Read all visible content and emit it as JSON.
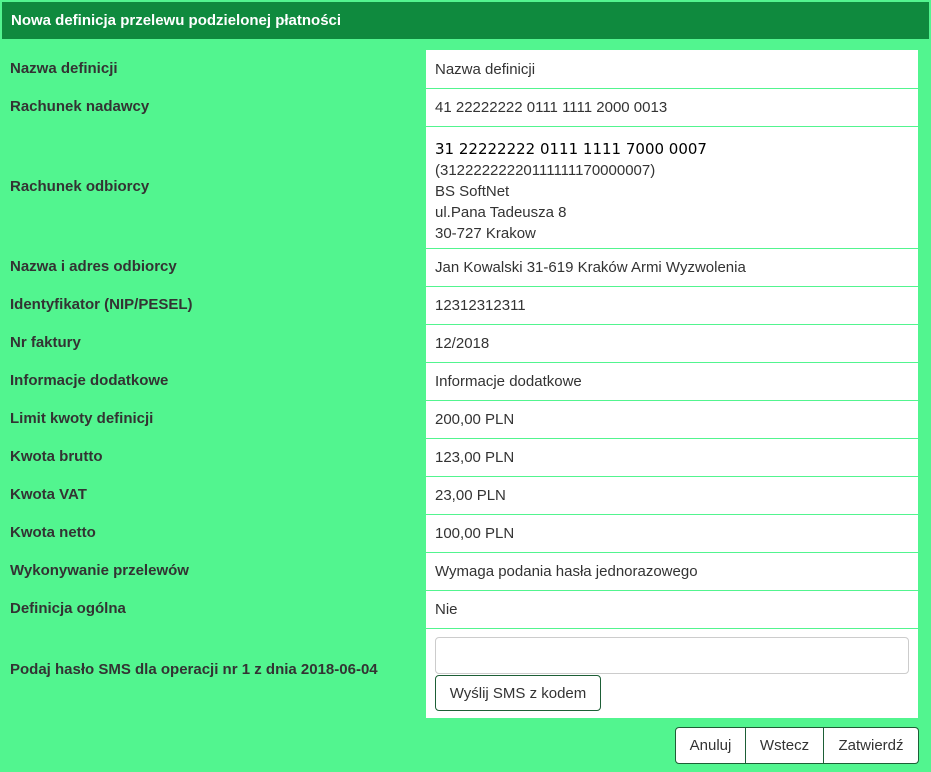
{
  "header": {
    "title": "Nowa definicja przelewu podzielonej płatności"
  },
  "fields": {
    "nazwa_definicji": {
      "label": "Nazwa definicji",
      "value": "Nazwa definicji"
    },
    "rachunek_nadawcy": {
      "label": "Rachunek nadawcy",
      "value": "41 22222222 0111 1111 2000 0013"
    },
    "rachunek_odbiorcy": {
      "label": "Rachunek odbiorcy",
      "account": "31 22222222 0111 1111 7000 0007",
      "account_raw": "(31222222220111111170000007)",
      "bank_name": "BS SoftNet",
      "street": "ul.Pana Tadeusza 8",
      "city": "30-727 Krakow"
    },
    "nazwa_adres_odbiorcy": {
      "label": "Nazwa i adres odbiorcy",
      "value": "Jan Kowalski 31-619 Kraków Armi Wyzwolenia"
    },
    "identyfikator": {
      "label": "Identyfikator (NIP/PESEL)",
      "value": "12312312311"
    },
    "nr_faktury": {
      "label": "Nr faktury",
      "value": "12/2018"
    },
    "informacje_dodatkowe": {
      "label": "Informacje dodatkowe",
      "value": "Informacje dodatkowe"
    },
    "limit_kwoty": {
      "label": "Limit kwoty definicji",
      "value": "200,00 PLN"
    },
    "kwota_brutto": {
      "label": "Kwota brutto",
      "value": "123,00 PLN"
    },
    "kwota_vat": {
      "label": "Kwota VAT",
      "value": "23,00 PLN"
    },
    "kwota_netto": {
      "label": "Kwota netto",
      "value": "100,00 PLN"
    },
    "wykonywanie": {
      "label": "Wykonywanie przelewów",
      "value": "Wymaga podania hasła jednorazowego"
    },
    "definicja_ogolna": {
      "label": "Definicja ogólna",
      "value": "Nie"
    },
    "sms": {
      "label": "Podaj hasło SMS dla operacji nr 1 z dnia 2018-06-04",
      "input_value": "",
      "send_button": "Wyślij SMS z kodem"
    }
  },
  "actions": {
    "cancel": "Anuluj",
    "back": "Wstecz",
    "confirm": "Zatwierdź"
  },
  "colors": {
    "header_bg": "#0f8a3e",
    "panel_bg": "#52f58f"
  }
}
